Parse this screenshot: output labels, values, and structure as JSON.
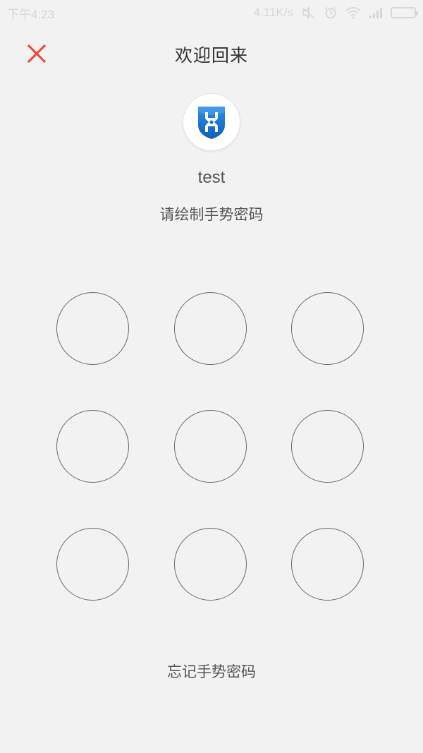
{
  "status_bar": {
    "time": "下午4:23",
    "network_speed": "4.11K/s",
    "icons": [
      "silent-icon",
      "alarm-icon",
      "wifi-icon",
      "signal-icon",
      "battery-icon"
    ]
  },
  "header": {
    "title": "欢迎回来",
    "close_icon": "close-icon",
    "close_color": "#f44336"
  },
  "profile": {
    "avatar_icon": "shield-logo-icon",
    "username": "test"
  },
  "gesture": {
    "prompt": "请绘制手势密码",
    "dots": [
      1,
      2,
      3,
      4,
      5,
      6,
      7,
      8,
      9
    ]
  },
  "footer": {
    "forgot_label": "忘记手势密码"
  }
}
